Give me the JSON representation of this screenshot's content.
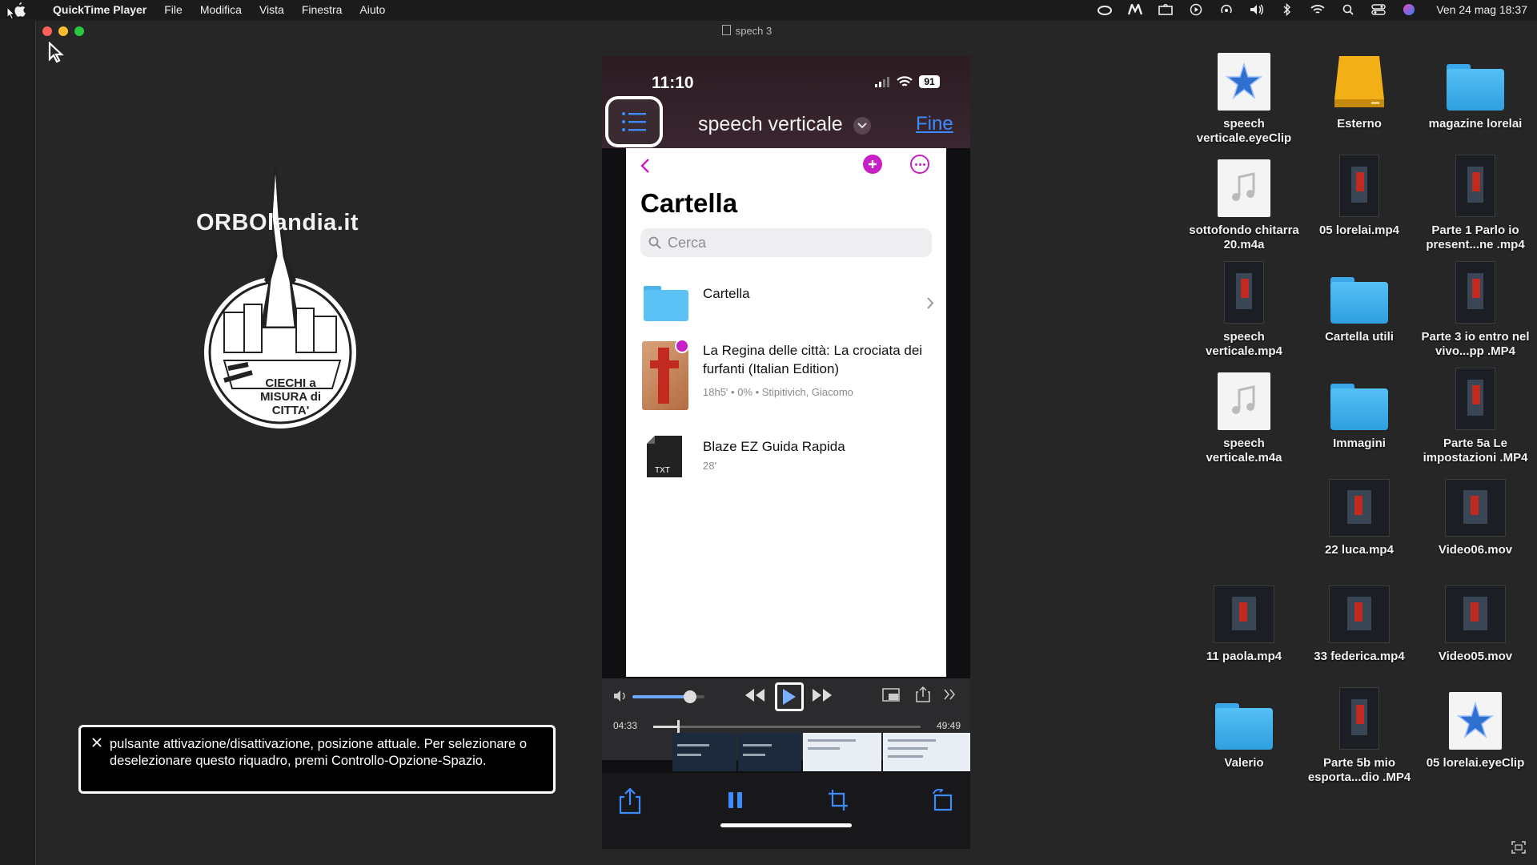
{
  "menubar": {
    "app_name": "QuickTime Player",
    "menus": [
      "File",
      "Modifica",
      "Vista",
      "Finestra",
      "Aiuto"
    ],
    "clock": "Ven 24 mag 18:37"
  },
  "window": {
    "title": "spech 3"
  },
  "logo": {
    "text": "ORBOlandia.it",
    "circle_text": "CIECHI a MISURA di CITTA'"
  },
  "phone": {
    "time": "11:10",
    "battery": "91",
    "doc_title": "speech verticale",
    "done_label": "Fine",
    "app": {
      "title": "Cartella",
      "search_placeholder": "Cerca",
      "rows": [
        {
          "label": "Cartella"
        },
        {
          "label": "La Regina delle città: La crociata dei furfanti (Italian Edition)",
          "duration": "18h5'",
          "progress": "0%",
          "author": "Stipitivich, Giacomo"
        },
        {
          "label": "Blaze EZ Guida Rapida",
          "duration": "28'"
        }
      ]
    },
    "player": {
      "current_time": "04:33",
      "duration": "49:49",
      "volume": 0.8,
      "position": 0.09
    }
  },
  "voiceover": {
    "text": "pulsante attivazione/disattivazione, posizione attuale. Per selezionare o deselezionare questo riquadro, premi Controllo-Opzione-Spazio."
  },
  "desktop": {
    "items": [
      {
        "name": "speech verticale.eyeClip",
        "icon": "eyeclip-icon"
      },
      {
        "name": "Esterno",
        "icon": "drive-icon"
      },
      {
        "name": "magazine lorelai",
        "icon": "folder-icon"
      },
      {
        "name": "sottofondo chitarra 20.m4a",
        "icon": "audio-file-icon"
      },
      {
        "name": "05 lorelai.mp4",
        "icon": "video-file-icon"
      },
      {
        "name": "Parte 1 Parlo io present...ne .mp4",
        "icon": "video-file-icon"
      },
      {
        "name": "speech verticale.mp4",
        "icon": "video-file-icon"
      },
      {
        "name": "Cartella utili",
        "icon": "folder-icon"
      },
      {
        "name": "Parte 3 io entro nel vivo...pp .MP4",
        "icon": "video-file-icon"
      },
      {
        "name": "speech verticale.m4a",
        "icon": "audio-file-icon"
      },
      {
        "name": "Immagini",
        "icon": "folder-icon"
      },
      {
        "name": "Parte 5a Le impostazioni .MP4",
        "icon": "video-file-icon"
      },
      {
        "name": "22 luca.mp4",
        "icon": "video-file-icon"
      },
      {
        "name": "Video06.mov",
        "icon": "video-file-icon"
      },
      {
        "name": "11 paola.mp4",
        "icon": "video-file-icon"
      },
      {
        "name": "33 federica.mp4",
        "icon": "video-file-icon"
      },
      {
        "name": "Video05.mov",
        "icon": "video-file-icon"
      },
      {
        "name": "Valerio",
        "icon": "folder-icon"
      },
      {
        "name": "Parte 5b mio esporta...dio .MP4",
        "icon": "video-file-icon"
      },
      {
        "name": "05 lorelai.eyeClip",
        "icon": "eyeclip-icon"
      }
    ]
  }
}
